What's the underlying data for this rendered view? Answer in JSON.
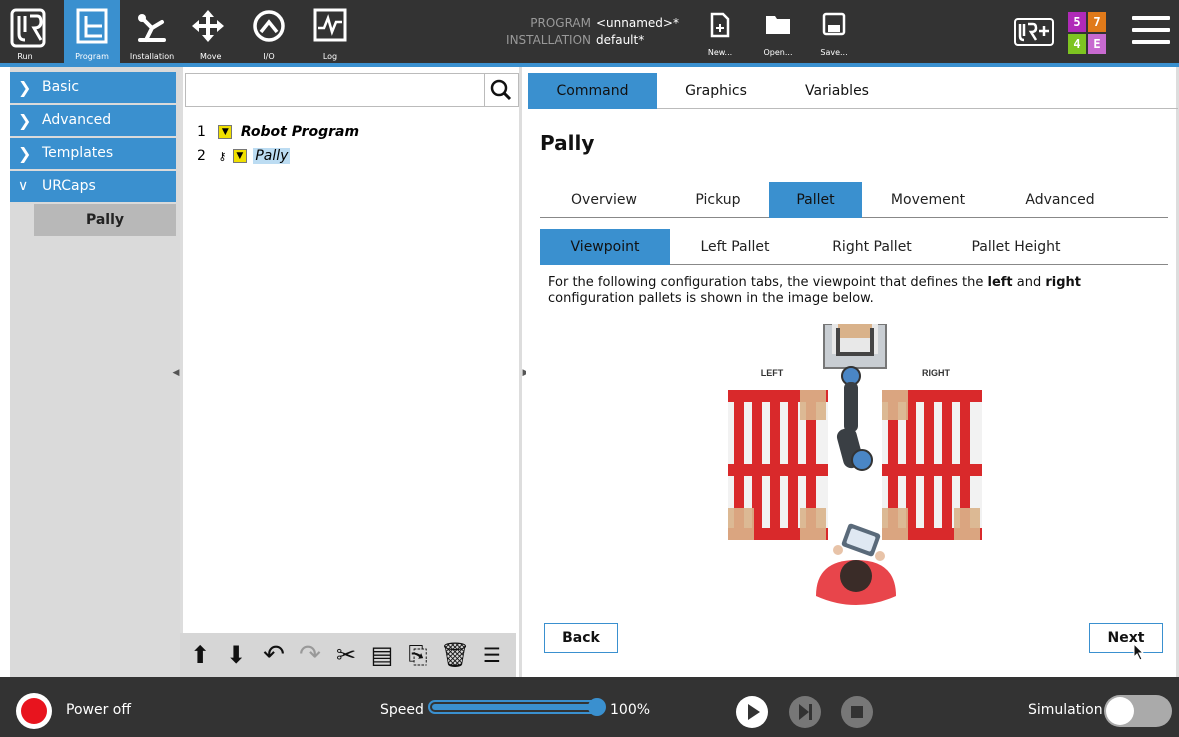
{
  "nav": {
    "run": "Run",
    "program": "Program",
    "installation": "Installation",
    "move": "Move",
    "io": "I/O",
    "log": "Log"
  },
  "header": {
    "program_label": "PROGRAM",
    "program_value": "<unnamed>*",
    "installation_label": "INSTALLATION",
    "installation_value": "default*",
    "new": "New...",
    "open": "Open...",
    "save": "Save..."
  },
  "badges": {
    "tl": "5",
    "tr": "7",
    "bl": "4",
    "br": "E"
  },
  "sidebar": {
    "items": [
      "Basic",
      "Advanced",
      "Templates",
      "URCaps"
    ],
    "sub": "Pally"
  },
  "tree": {
    "rows": [
      {
        "num": "1",
        "label": "Robot Program"
      },
      {
        "num": "2",
        "label": "Pally"
      }
    ]
  },
  "command_tabs": [
    "Command",
    "Graphics",
    "Variables"
  ],
  "page_title": "Pally",
  "main_tabs": [
    "Overview",
    "Pickup",
    "Pallet",
    "Movement",
    "Advanced"
  ],
  "sub_tabs": [
    "Viewpoint",
    "Left Pallet",
    "Right Pallet",
    "Pallet Height"
  ],
  "description": {
    "part1": "For the following configuration tabs, the viewpoint that defines the ",
    "left": "left",
    "and": " and ",
    "right": "right",
    "part2": "configuration pallets is shown in the image below."
  },
  "illustration": {
    "left": "LEFT",
    "right": "RIGHT"
  },
  "buttons": {
    "back": "Back",
    "next": "Next"
  },
  "bottom": {
    "power": "Power off",
    "speed_label": "Speed",
    "speed_value": "100%",
    "speed": 1.0,
    "simulation": "Simulation"
  },
  "colors": {
    "accent": "#3a90cf",
    "power": "#e8141e",
    "pallet": "#d9292b"
  }
}
